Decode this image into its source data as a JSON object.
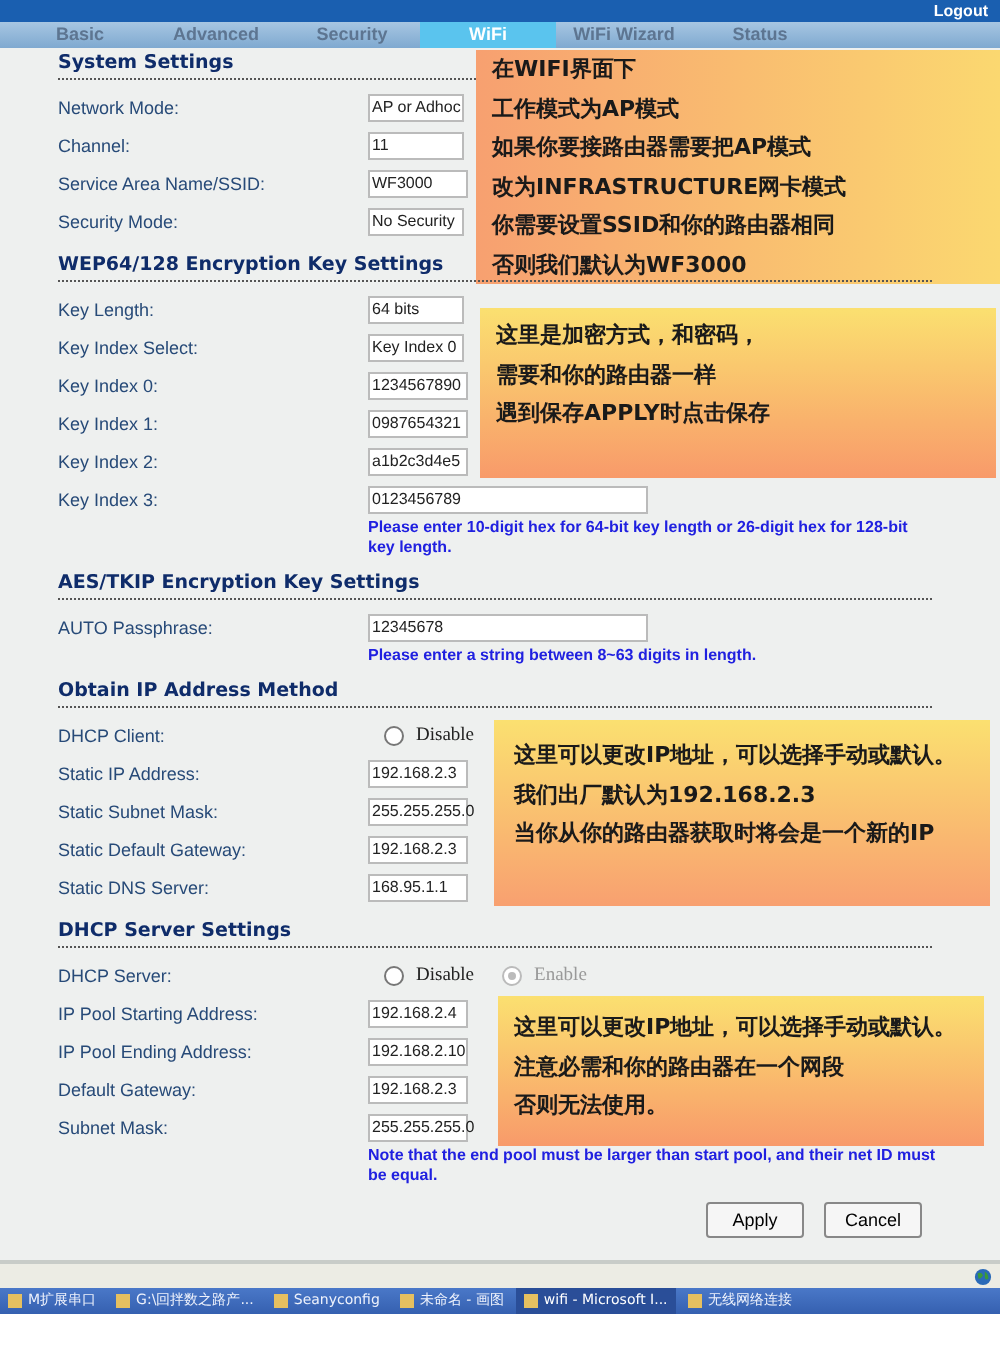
{
  "header": {
    "logout": "Logout"
  },
  "tabs": [
    {
      "label": "Basic",
      "selected": false
    },
    {
      "label": "Advanced",
      "selected": false
    },
    {
      "label": "Security",
      "selected": false
    },
    {
      "label": "WiFi",
      "selected": true
    },
    {
      "label": "WiFi Wizard",
      "selected": false
    },
    {
      "label": "Status",
      "selected": false
    }
  ],
  "sections": [
    {
      "title": "System Settings",
      "rows": [
        {
          "label": "Network Mode:",
          "kind": "select",
          "value": "AP or Adhoc"
        },
        {
          "label": "Channel:",
          "kind": "select",
          "value": "11"
        },
        {
          "label": "Service Area Name/SSID:",
          "kind": "text",
          "value": "WF3000"
        },
        {
          "label": "Security Mode:",
          "kind": "select",
          "value": "No Security"
        }
      ]
    },
    {
      "title": "WEP64/128 Encryption Key Settings",
      "rows": [
        {
          "label": "Key Length:",
          "kind": "select",
          "value": "64 bits"
        },
        {
          "label": "Key Index Select:",
          "kind": "select",
          "value": "Key Index 0"
        },
        {
          "label": "Key Index 0:",
          "kind": "text",
          "value": "1234567890"
        },
        {
          "label": "Key Index 1:",
          "kind": "text",
          "value": "0987654321"
        },
        {
          "label": "Key Index 2:",
          "kind": "text",
          "value": "a1b2c3d4e5"
        },
        {
          "label": "Key Index 3:",
          "kind": "longtext",
          "value": "0123456789"
        }
      ],
      "note": "Please enter 10-digit hex for 64-bit key length or 26-digit hex for 128-bit key length."
    },
    {
      "title": "AES/TKIP Encryption Key Settings",
      "rows": [
        {
          "label": "AUTO Passphrase:",
          "kind": "longtext",
          "value": "12345678"
        }
      ],
      "note": "Please enter a string between 8~63 digits in length."
    },
    {
      "title": "Obtain IP Address Method",
      "rows": [
        {
          "label": "DHCP Client:",
          "kind": "radio",
          "options": [
            {
              "label": "Disable",
              "selected": false,
              "dimmed": false
            }
          ]
        },
        {
          "label": "Static IP Address:",
          "kind": "text",
          "value": "192.168.2.3"
        },
        {
          "label": "Static Subnet Mask:",
          "kind": "text",
          "value": "255.255.255.0"
        },
        {
          "label": "Static Default Gateway:",
          "kind": "text",
          "value": "192.168.2.3"
        },
        {
          "label": "Static DNS Server:",
          "kind": "text",
          "value": "168.95.1.1"
        }
      ]
    },
    {
      "title": "DHCP Server Settings",
      "rows": [
        {
          "label": "DHCP Server:",
          "kind": "radio",
          "options": [
            {
              "label": "Disable",
              "selected": false,
              "dimmed": false
            },
            {
              "label": "Enable",
              "selected": true,
              "dimmed": true
            }
          ]
        },
        {
          "label": "IP Pool Starting Address:",
          "kind": "text",
          "value": "192.168.2.4"
        },
        {
          "label": "IP Pool Ending Address:",
          "kind": "text",
          "value": "192.168.2.10"
        },
        {
          "label": "Default Gateway:",
          "kind": "text",
          "value": "192.168.2.3"
        },
        {
          "label": "Subnet Mask:",
          "kind": "text",
          "value": "255.255.255.0"
        }
      ],
      "note": "Note that the end pool must be larger than start pool, and their net ID must be equal."
    }
  ],
  "buttons": [
    "Apply",
    "Cancel"
  ],
  "callouts": [
    {
      "lines": [
        "在WIFI界面下",
        "工作模式为AP模式",
        "如果你要接路由器需要把AP模式",
        "改为INFRASTRUCTURE网卡模式",
        "你需要设置SSID和你的路由器相同",
        "否则我们默认为WF3000"
      ]
    },
    {
      "lines": [
        "这里是加密方式，和密码，",
        "需要和你的路由器一样",
        "遇到保存APPLY时点击保存"
      ]
    },
    {
      "lines": [
        "这里可以更改IP地址，可以选择手动或默认。",
        "我们出厂默认为192.168.2.3",
        "当你从你的路由器获取时将会是一个新的IP"
      ]
    },
    {
      "lines": [
        "这里可以更改IP地址，可以选择手动或默认。",
        "注意必需和你的路由器在一个网段",
        "否则无法使用。"
      ]
    }
  ],
  "taskbar": [
    {
      "label": "M扩展串口",
      "selected": false
    },
    {
      "label": "G:\\回拌数之路产...",
      "selected": false
    },
    {
      "label": "Seanyconfig",
      "selected": false
    },
    {
      "label": "未命名 - 画图",
      "selected": false
    },
    {
      "label": "wifi - Microsoft I...",
      "selected": true
    },
    {
      "label": "无线网络连接",
      "selected": false
    }
  ]
}
